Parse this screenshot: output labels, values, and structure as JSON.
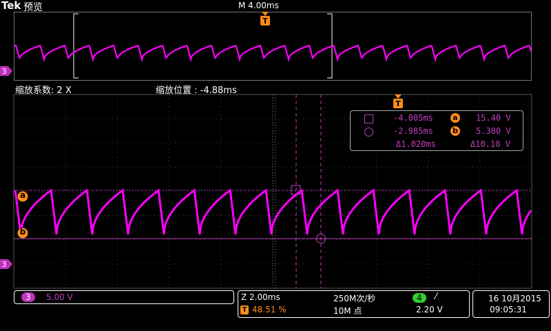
{
  "header": {
    "brand": "Tek",
    "mode": "预览",
    "timebase": "M 4.00ms",
    "trigger_marker": "T"
  },
  "zoom_info": {
    "factor_label": "缩放系数: 2 X",
    "position_label": "缩放位置 : -4.88ms"
  },
  "channel_marker": "3",
  "cursor_readout": {
    "row1_time": "-4.005ms",
    "row1_cursor_label": "a",
    "row1_value": "15.40 V",
    "row2_time": "-2.985ms",
    "row2_cursor_label": "b",
    "row2_value": "5.300 V",
    "delta_time": "Δ1.020ms",
    "delta_value": "Δ10.10 V"
  },
  "cursor_labels": {
    "a": "a",
    "b": "b"
  },
  "bottom_bar": {
    "channel_badge": "3",
    "channel_scale": "5.00 V",
    "zoom_time": "Z 2.00ms",
    "trigger_icon": "T",
    "trigger_pos": "48.51 %",
    "sample_rate": "250M次/秒",
    "record_length": "10M 点",
    "trigger_channel": "4",
    "trigger_slope_icon": "rising-edge-icon",
    "trigger_slope": "⁄",
    "trigger_level": "2.20 V",
    "date": "16 10月2015",
    "time": "09:05:31"
  },
  "colors": {
    "waveform": "#ff00ff",
    "cursor": "#c040c0",
    "accent_orange": "#ff8c1a",
    "grid": "#3a3a3a",
    "trigger_channel_green": "#33cc33"
  }
}
